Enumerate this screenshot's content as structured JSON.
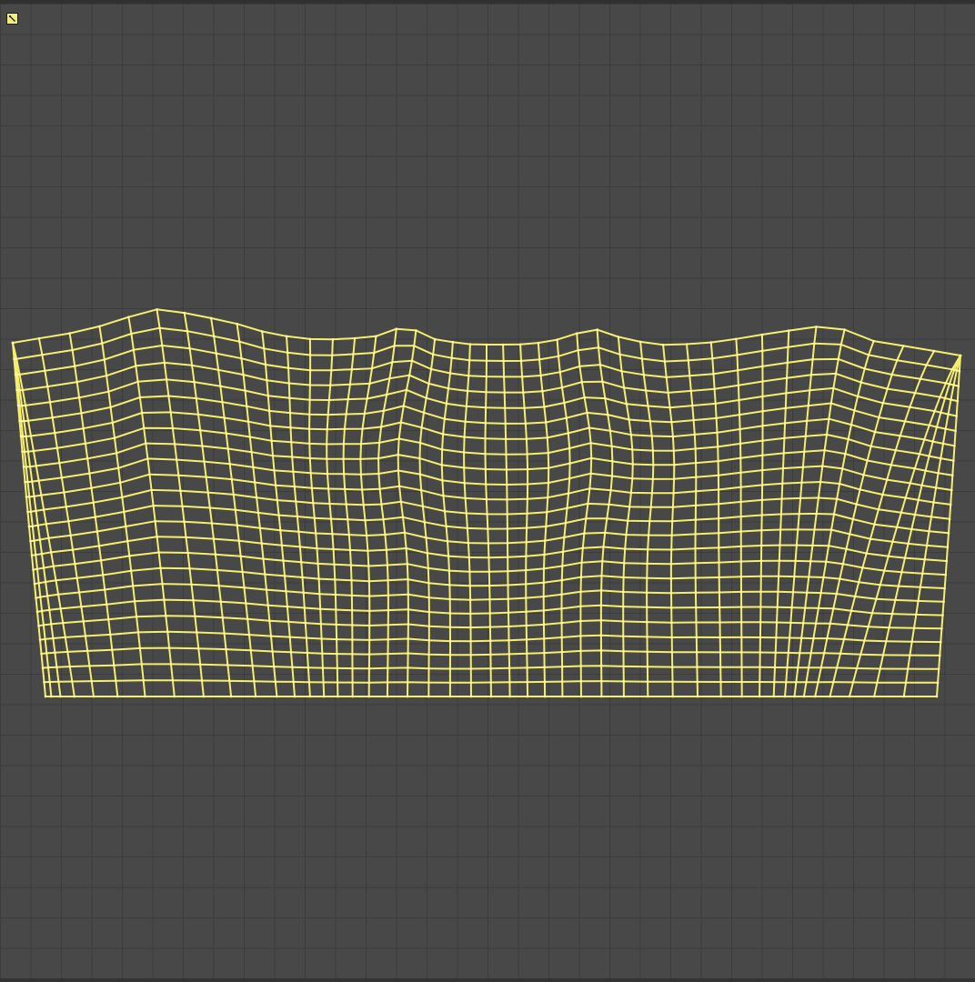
{
  "editor": {
    "mode": "uv-editor",
    "background_color": "#484848",
    "grid_color": "#3c3c3c",
    "grid_divisions": 32
  },
  "corner_handle": {
    "icon": "uv-corner-handle-icon",
    "color": "#f2ec7a"
  },
  "mesh": {
    "wire_color": "#f5ee6e",
    "vertex_color": "#fff7a0",
    "columns": 46,
    "rows": 24
  }
}
